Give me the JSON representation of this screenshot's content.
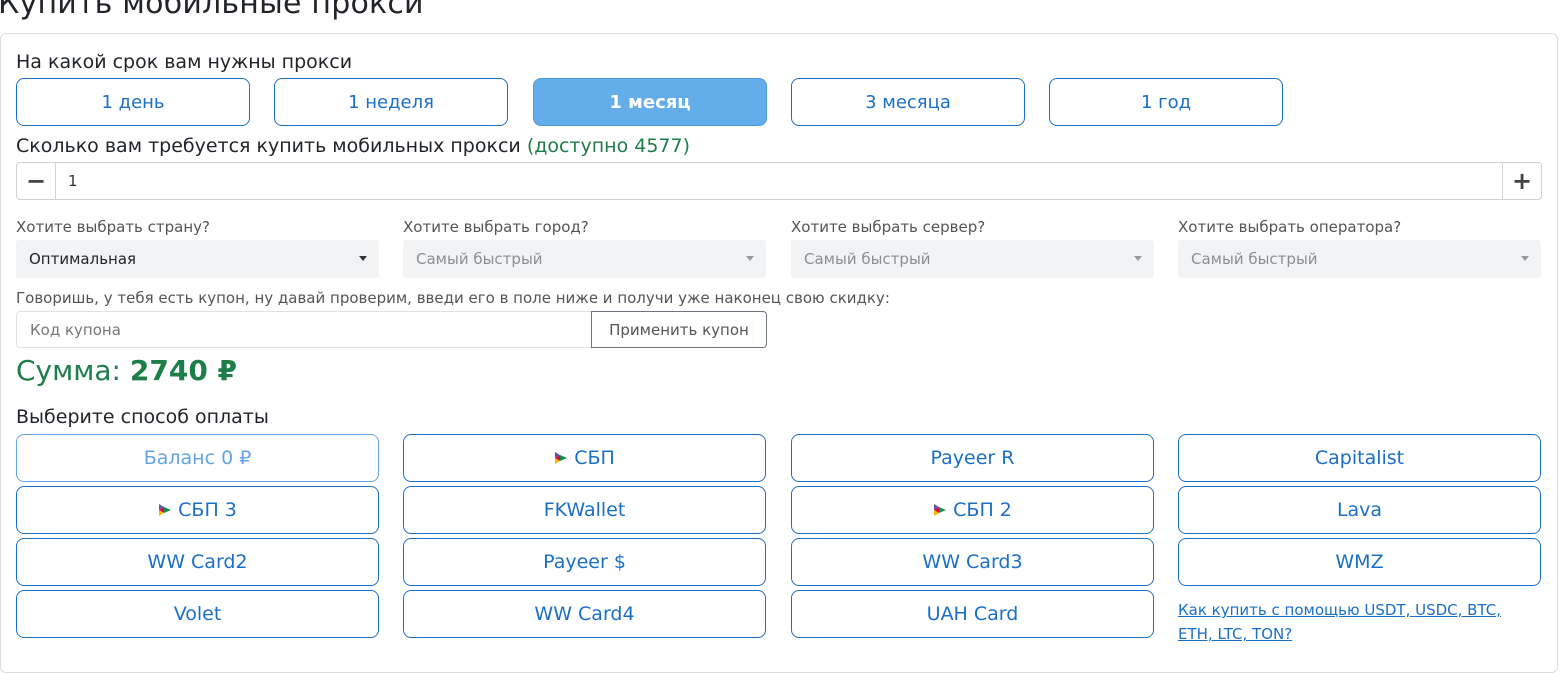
{
  "page_title": "Купить мобильные прокси",
  "term": {
    "label": "На какой срок вам нужны прокси",
    "options": [
      "1 день",
      "1 неделя",
      "1 месяц",
      "3 месяца",
      "1 год"
    ],
    "selected": "1 месяц"
  },
  "quantity": {
    "label": "Сколько вам требуется купить мобильных прокси",
    "available": "(доступно 4577)",
    "minus": "−",
    "plus": "+",
    "value": "1"
  },
  "filters": [
    {
      "label": "Хотите выбрать страну?",
      "value": "Оптимальная",
      "disabled": false
    },
    {
      "label": "Хотите выбрать город?",
      "value": "Самый быстрый",
      "disabled": true
    },
    {
      "label": "Хотите выбрать сервер?",
      "value": "Самый быстрый",
      "disabled": true
    },
    {
      "label": "Хотите выбрать оператора?",
      "value": "Самый быстрый",
      "disabled": true
    }
  ],
  "coupon": {
    "label": "Говоришь, у тебя есть купон, ну давай проверим, введи его в поле ниже и получи уже наконец свою скидку:",
    "placeholder": "Код купона",
    "apply_label": "Применить купон"
  },
  "sum": {
    "label": "Сумма:",
    "value": "2740 ₽"
  },
  "payment": {
    "label": "Выберите способ оплаты",
    "methods": [
      {
        "label": "Баланс 0 ₽",
        "icon": "",
        "muted": true
      },
      {
        "label": "СБП",
        "icon": "sbp-icon"
      },
      {
        "label": "Payeer R",
        "icon": ""
      },
      {
        "label": "Capitalist",
        "icon": ""
      },
      {
        "label": "СБП 3",
        "icon": "sbp-icon"
      },
      {
        "label": "FKWallet",
        "icon": ""
      },
      {
        "label": "СБП 2",
        "icon": "sbp-icon"
      },
      {
        "label": "Lava",
        "icon": ""
      },
      {
        "label": "WW Card2",
        "icon": ""
      },
      {
        "label": "Payeer $",
        "icon": ""
      },
      {
        "label": "WW Card3",
        "icon": ""
      },
      {
        "label": "WMZ",
        "icon": ""
      },
      {
        "label": "Volet",
        "icon": ""
      },
      {
        "label": "WW Card4",
        "icon": ""
      },
      {
        "label": "UAH Card",
        "icon": ""
      }
    ],
    "help_link": "Как купить с помощью USDT, USDC, BTC, ETH, LTC, TON?"
  },
  "colors": {
    "accent": "#1a6fc9",
    "active_bg": "#63aeea",
    "success": "#1e7e4a"
  }
}
